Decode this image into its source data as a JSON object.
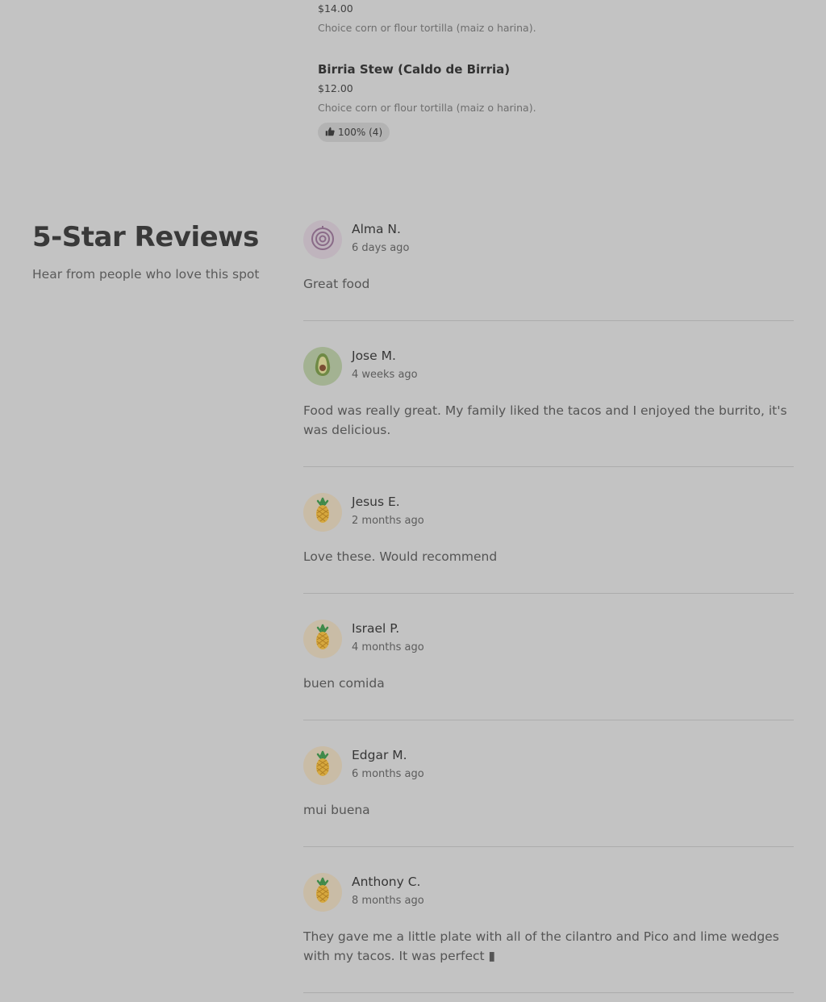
{
  "menu": {
    "items": [
      {
        "name": "",
        "price": "$14.00",
        "description": "Choice corn or flour tortilla (maiz o harina)."
      },
      {
        "name": "Birria Stew (Caldo de Birria)",
        "price": "$12.00",
        "description": "Choice corn or flour tortilla (maiz o harina).",
        "rating_label": "100% (4)",
        "rating_icon": "thumbs-up-icon"
      }
    ]
  },
  "reviews_section": {
    "title": "5-Star Reviews",
    "subtitle": "Hear from people who love this spot"
  },
  "reviews": [
    {
      "name": "Alma N.",
      "time": "6 days ago",
      "text": "Great food",
      "avatar_icon": "onion-icon",
      "avatar_color": "#bfb4bd"
    },
    {
      "name": "Jose M.",
      "time": "4 weeks ago",
      "text": "Food was really great. My family liked the tacos and I enjoyed the burrito, it's was delicious.",
      "avatar_icon": "avocado-icon",
      "avatar_color": "#a3b292"
    },
    {
      "name": "Jesus E.",
      "time": "2 months ago",
      "text": "Love these. Would recommend",
      "avatar_icon": "pineapple-icon",
      "avatar_color": "#c9bca6"
    },
    {
      "name": "Israel P.",
      "time": "4 months ago",
      "text": "buen comida",
      "avatar_icon": "pineapple-icon",
      "avatar_color": "#c9bca6"
    },
    {
      "name": "Edgar M.",
      "time": "6 months ago",
      "text": "mui buena",
      "avatar_icon": "pineapple-icon",
      "avatar_color": "#c9bca6"
    },
    {
      "name": "Anthony C.",
      "time": "8 months ago",
      "text": "They gave me a little plate with all of the cilantro and Pico and lime wedges with my tacos. It was perfect ▮",
      "avatar_icon": "pineapple-icon",
      "avatar_color": "#c9bca6"
    }
  ]
}
